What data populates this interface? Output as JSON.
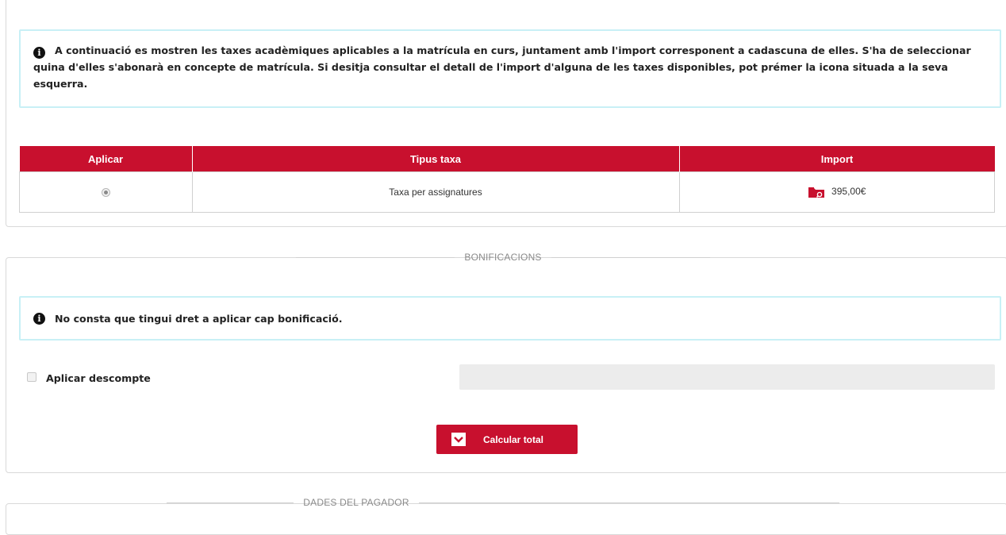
{
  "info_top": {
    "text": "A continuació es mostren les taxes acadèmiques aplicables a la matrícula en curs, juntament amb l'import corresponent a cadascuna de elles. S'ha de seleccionar quina d'elles s'abonarà en concepte de matrícula. Si desitja consultar el detall de l'import d'alguna de les taxes disponibles, pot prémer la icona situada a la seva esquerra."
  },
  "taxes_table": {
    "headers": [
      "Aplicar",
      "Tipus taxa",
      "Import"
    ],
    "rows": [
      {
        "selected": true,
        "type": "Taxa per assignatures",
        "amount": "395,00€"
      }
    ]
  },
  "bonificacions": {
    "legend": "BONIFICACIONS",
    "info_text": "No consta que tingui dret a aplicar cap bonificació.",
    "discount_label": "Aplicar descompte",
    "discount_checked": false,
    "calc_button": "Calcular total"
  },
  "payer": {
    "legend": "DADES DEL PAGADOR"
  },
  "colors": {
    "accent": "#c8102e",
    "info_border": "#c8f0f6",
    "panel_border": "#d9d9d9"
  },
  "icons": {
    "info": "info-circle-icon",
    "import_detail": "folder-search-icon",
    "button": "chevron-down-icon"
  }
}
